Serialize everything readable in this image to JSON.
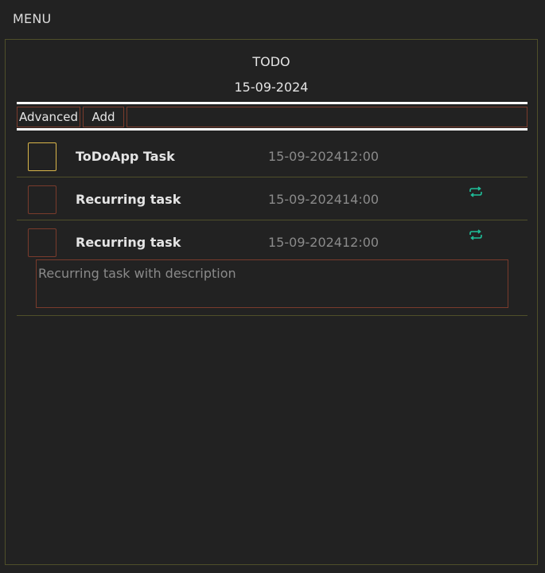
{
  "header": {
    "menu_label": "MENU"
  },
  "panel": {
    "title": "TODO",
    "date": "15-09-2024"
  },
  "toolbar": {
    "advanced_label": "Advanced",
    "add_label": "Add",
    "new_task_value": "",
    "new_task_placeholder": ""
  },
  "tasks": [
    {
      "name": "ToDoApp Task",
      "date": "15-09-2024",
      "time": "12:00",
      "recurring": false,
      "focused": true
    },
    {
      "name": "Recurring task",
      "date": "15-09-2024",
      "time": "14:00",
      "recurring": true,
      "focused": false
    },
    {
      "name": "Recurring task",
      "date": "15-09-2024",
      "time": "12:00",
      "recurring": true,
      "focused": false,
      "description": "Recurring task with description"
    }
  ],
  "icons": {
    "repeat": "repeat-icon"
  },
  "colors": {
    "background": "#222222",
    "accent_border": "#7a3b2c",
    "focus_border": "#d9b64a",
    "panel_border": "#4f4f2a",
    "recurring_icon": "#1fbf9a",
    "muted_text": "#8a8a8a"
  }
}
